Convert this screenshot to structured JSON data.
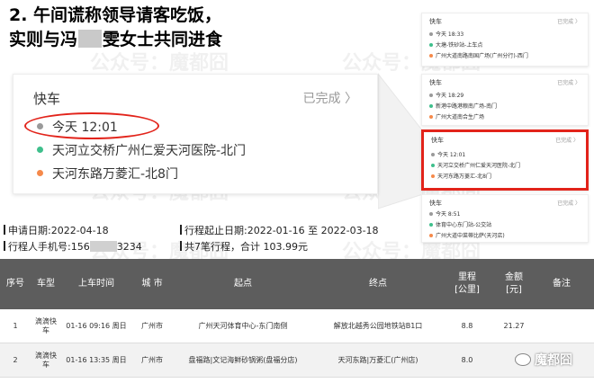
{
  "headline": {
    "line1": "2. 午间谎称领导请客吃饭，",
    "line2_part1": "实则与冯",
    "line2_part2": "雯女士共同进食"
  },
  "watermark": "公众号：魔都囧",
  "big_card": {
    "title": "快车",
    "status": "已完成 〉",
    "time": "今天 12:01",
    "from": "天河立交桥广州仁爱天河医院-北门",
    "to": "天河东路万菱汇-北8门"
  },
  "mini_cards": [
    {
      "title": "快车",
      "status": "已完成 〉",
      "time": "今天 18:33",
      "from": "大塘-铁砂站-上车点",
      "to": "广州大道南路南国广场(广州分行)-西门"
    },
    {
      "title": "快车",
      "status": "已完成 〉",
      "time": "今天 18:29",
      "from": "新港中路港粮南广场-南门",
      "to": "广州大道南合生广场"
    },
    {
      "title": "快车",
      "status": "已完成 〉",
      "time": "今天 12:01",
      "from": "天河立交桥广州仁爱天河医院-北门",
      "to": "天河东路万菱汇-北8门"
    },
    {
      "title": "快车",
      "status": "已完成 〉",
      "time": "今天 8:51",
      "from": "体育中心东门站-公交站",
      "to": "广州大道中菜蒂比萨(天河店)"
    }
  ],
  "info": {
    "apply_date": "申请日期:2022-04-18",
    "phone_prefix": "行程人手机号:156",
    "phone_suffix": "3234",
    "trip_range": "行程起止日期:2022-01-16 至 2022-03-18",
    "total": "共7笔行程，合计 103.99元"
  },
  "table": {
    "headers": [
      "序号",
      "车型",
      "上车时间",
      "城 市",
      "起点",
      "终点",
      "里程\n[公里]",
      "金额\n[元]",
      "备注"
    ],
    "rows": [
      {
        "no": "1",
        "car": "滴滴快车",
        "time": "01-16 09:16 周日",
        "city": "广州市",
        "from": "广州天河体育中心-东门南侧",
        "to": "解放北越秀公园地铁站B1口",
        "km": "8.8",
        "amount": "21.27",
        "note": ""
      },
      {
        "no": "2",
        "car": "滴滴快车",
        "time": "01-16 13:35 周日",
        "city": "广州市",
        "from": "盘福路|文记海鲜砂锅粥(盘福分店)",
        "to": "天河东路|万菱汇(广州店)",
        "km": "8.0",
        "amount": "",
        "note": ""
      }
    ]
  },
  "brand": "魔都囧",
  "colors": {
    "highlight": "#e2231a",
    "header_bg": "#5d5d5d",
    "dot_green": "#3fbf8c",
    "dot_orange": "#f5894a",
    "dot_gray": "#9a9a9a"
  }
}
